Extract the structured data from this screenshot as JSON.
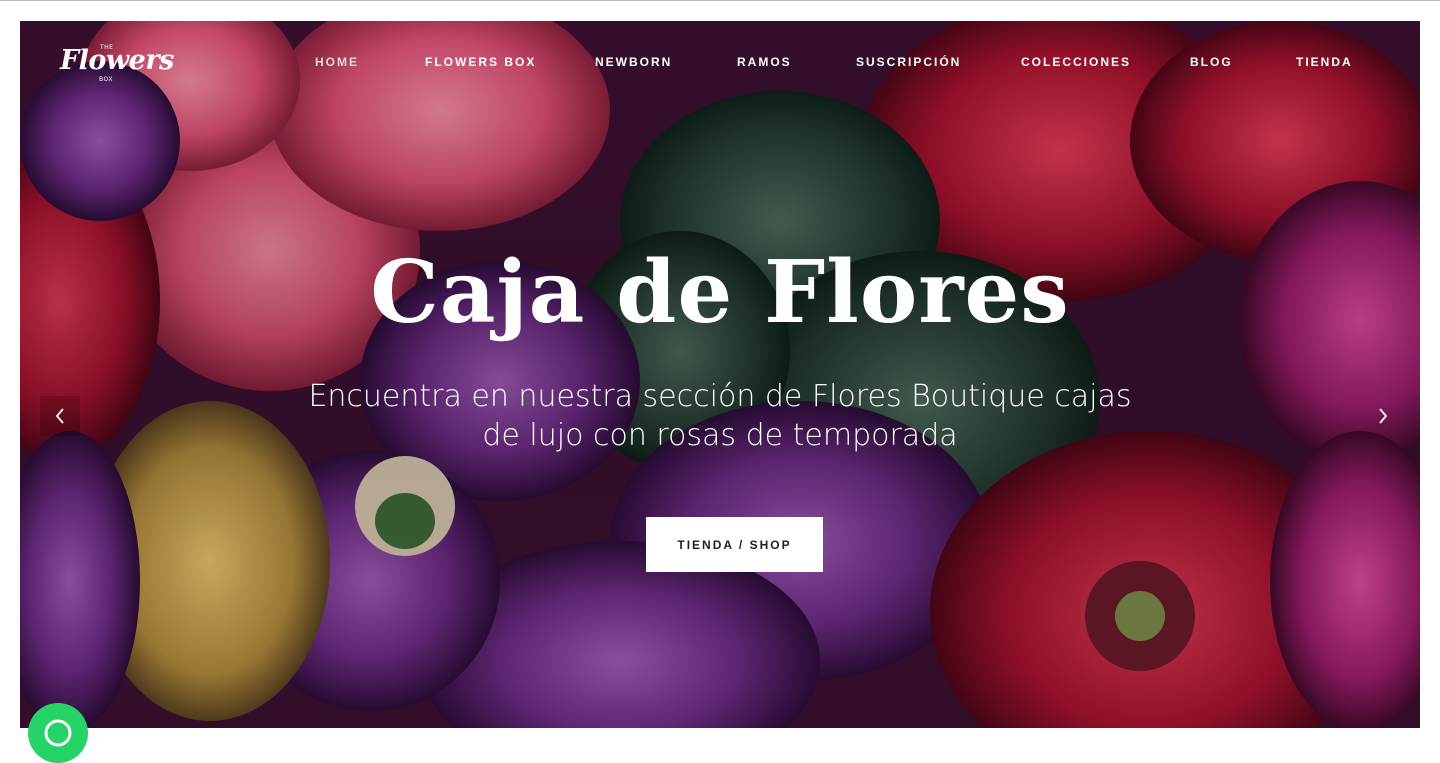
{
  "brand": {
    "logo_the": "THE",
    "logo_name": "Flowers",
    "logo_box": "BOX"
  },
  "nav": {
    "items": [
      {
        "label": "HOME",
        "active": true
      },
      {
        "label": "FLOWERS BOX",
        "active": false
      },
      {
        "label": "NEWBORN",
        "active": false
      },
      {
        "label": "RAMOS",
        "active": false
      },
      {
        "label": "SUSCRIPCIÓN",
        "active": false
      },
      {
        "label": "COLECCIONES",
        "active": false
      },
      {
        "label": "BLOG",
        "active": false
      },
      {
        "label": "TIENDA",
        "active": false
      }
    ]
  },
  "hero": {
    "title": "Caja de Flores",
    "subtitle": "Encuentra en nuestra sección de Flores Boutique cajas de lujo con rosas de temporada",
    "cta_label": "TIENDA / SHOP",
    "prev_icon": "chevron-left-icon",
    "next_icon": "chevron-right-icon"
  },
  "floating": {
    "whatsapp_icon": "whatsapp-icon",
    "whatsapp_color": "#25d366"
  },
  "colors": {
    "text_on_hero": "#ffffff",
    "cta_background": "#ffffff",
    "cta_text": "#222222"
  }
}
